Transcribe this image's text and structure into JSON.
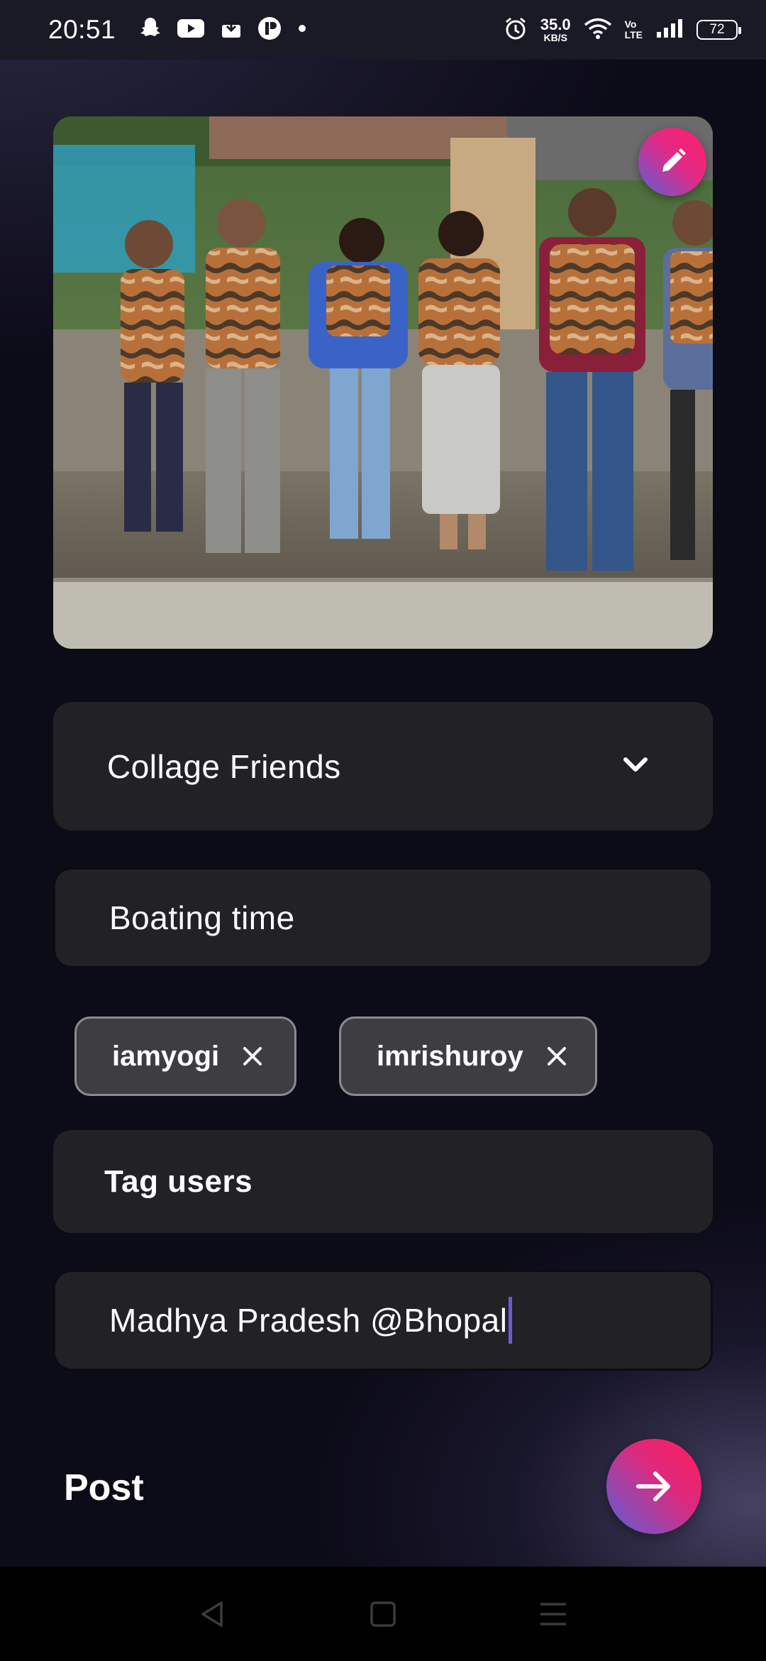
{
  "status_bar": {
    "time": "20:51",
    "speed_value": "35.0",
    "speed_unit": "KB/S",
    "volte_top": "Vo",
    "volte_bottom": "LTE",
    "battery": "72",
    "icons": [
      "snapchat-icon",
      "youtube-icon",
      "download-icon",
      "app-icon",
      "dot-icon",
      "alarm-icon",
      "wifi-icon",
      "signal-icon",
      "battery-icon"
    ]
  },
  "photo": {
    "icon": "group-photo-image"
  },
  "edit_button": {
    "icon": "pencil-icon"
  },
  "album_dropdown": {
    "selected": "Collage Friends",
    "icon": "chevron-down-icon"
  },
  "caption_field": {
    "value": "Boating time"
  },
  "tags": [
    {
      "label": "iamyogi",
      "icon": "close-icon"
    },
    {
      "label": "imrishuroy",
      "icon": "close-icon"
    }
  ],
  "tag_input": {
    "placeholder": "Tag users"
  },
  "location_field": {
    "value": "Madhya Pradesh @Bhopal"
  },
  "footer": {
    "post_label": "Post",
    "send_icon": "arrow-right-icon"
  },
  "nav": {
    "icons": [
      "back-icon",
      "home-icon",
      "menu-icon"
    ]
  },
  "colors": {
    "background": "#0c0b18",
    "field": "#222226",
    "chip": "#3e3e42",
    "accent_pink": "#ff1e6a",
    "accent_blue": "#5b5fd8",
    "cursor": "#6b5bd6"
  }
}
